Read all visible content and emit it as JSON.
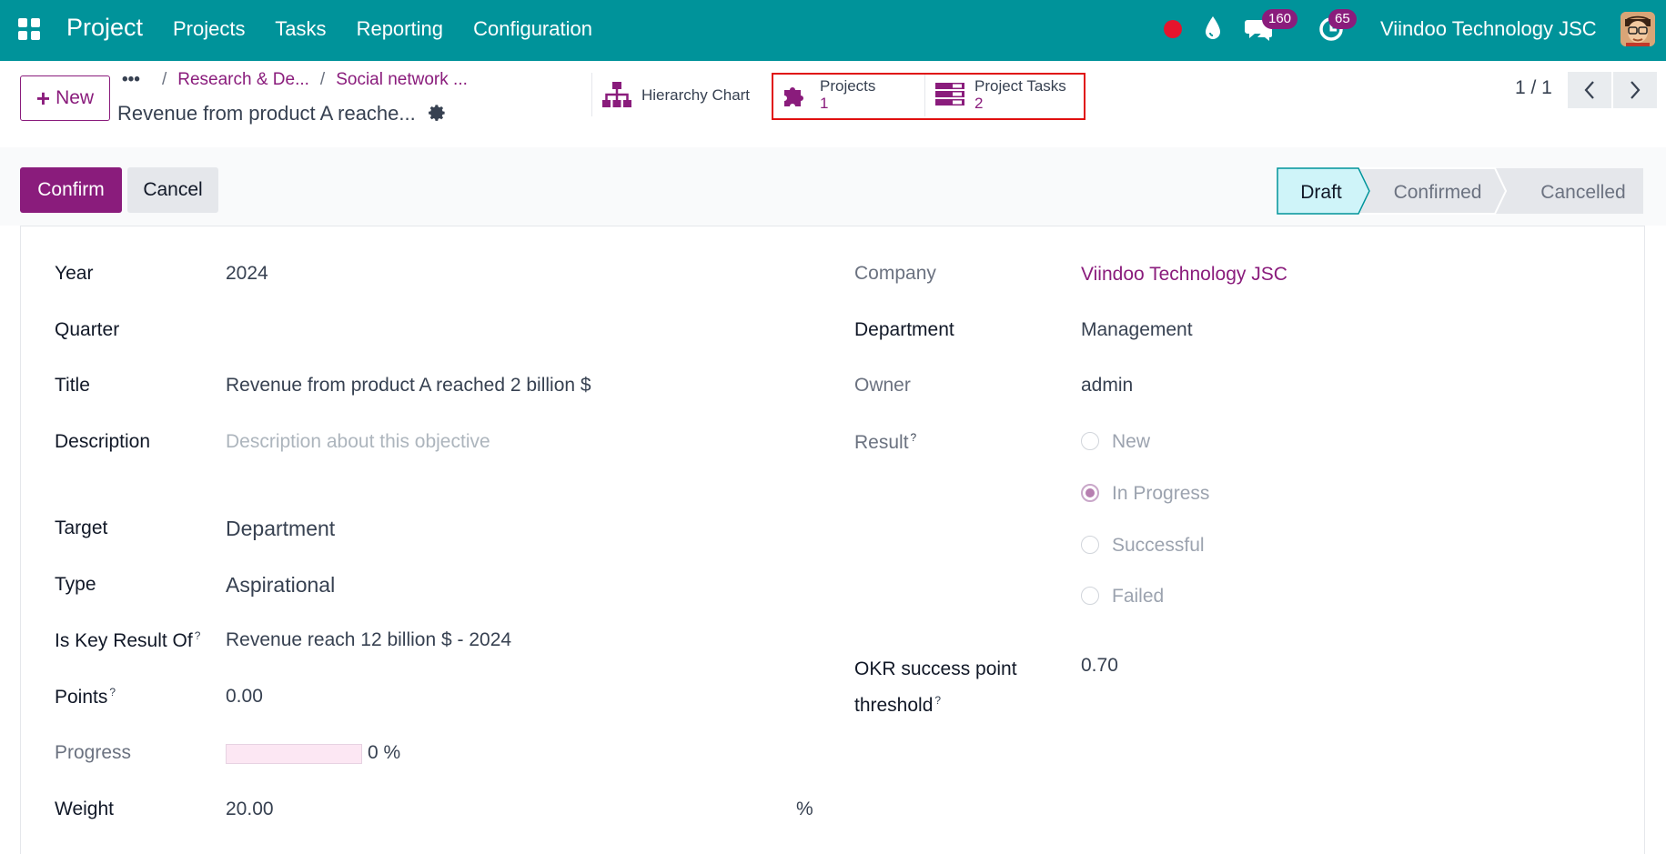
{
  "navbar": {
    "brand": "Project",
    "menu": [
      "Projects",
      "Tasks",
      "Reporting",
      "Configuration"
    ],
    "messages_count": "160",
    "activities_count": "65",
    "company": "Viindoo Technology JSC",
    "accent_color": "#00939a"
  },
  "control_panel": {
    "new_label": "New",
    "breadcrumb": [
      "Research & De...",
      "Social network ..."
    ],
    "record_title": "Revenue from product A reache...",
    "smart_buttons": [
      {
        "icon": "hierarchy-icon",
        "label": "Hierarchy Chart"
      },
      {
        "icon": "puzzle-icon",
        "label": "Projects",
        "count": "1"
      },
      {
        "icon": "tasks-icon",
        "label": "Project Tasks",
        "count": "2"
      }
    ],
    "pager": "1 / 1"
  },
  "status_bar": {
    "confirm_label": "Confirm",
    "cancel_label": "Cancel",
    "stages": [
      "Draft",
      "Confirmed",
      "Cancelled"
    ],
    "current_stage": "Draft"
  },
  "form": {
    "year": {
      "label": "Year",
      "value": "2024"
    },
    "quarter": {
      "label": "Quarter",
      "value": ""
    },
    "title": {
      "label": "Title",
      "value": "Revenue from product A reached 2 billion $"
    },
    "description": {
      "label": "Description",
      "placeholder": "Description about this objective"
    },
    "target": {
      "label": "Target",
      "value": "Department"
    },
    "type": {
      "label": "Type",
      "value": "Aspirational"
    },
    "key_result_of": {
      "label": "Is Key Result Of",
      "value": "Revenue reach 12 billion $ - 2024"
    },
    "points": {
      "label": "Points",
      "value": "0.00"
    },
    "progress": {
      "label": "Progress",
      "value": 0,
      "display": "0 %"
    },
    "weight": {
      "label": "Weight",
      "value": "20.00",
      "unit": "%"
    },
    "company": {
      "label": "Company",
      "value": "Viindoo Technology JSC"
    },
    "department": {
      "label": "Department",
      "value": "Management"
    },
    "owner": {
      "label": "Owner",
      "value": "admin"
    },
    "result": {
      "label": "Result",
      "options": [
        "New",
        "In Progress",
        "Successful",
        "Failed"
      ],
      "selected": "In Progress"
    },
    "okr_threshold": {
      "label_line1": "OKR success point",
      "label_line2": "threshold",
      "value": "0.70"
    },
    "help_mark": "?"
  }
}
